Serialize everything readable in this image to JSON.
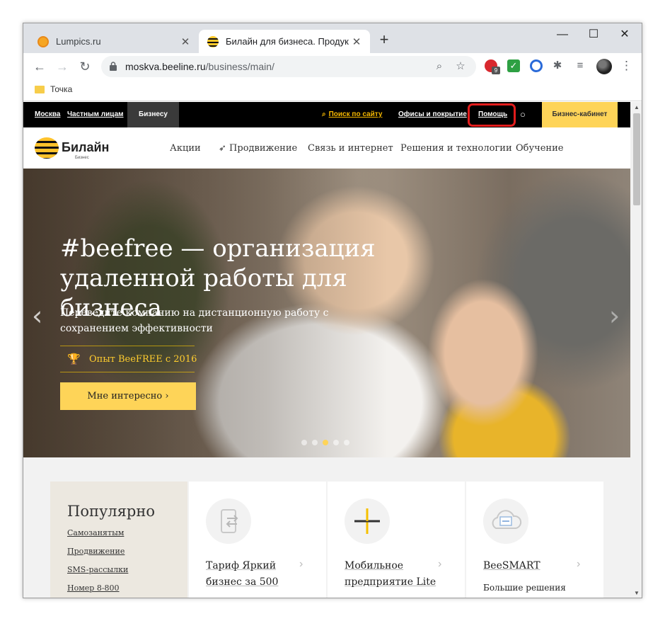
{
  "browser": {
    "tabs": [
      {
        "title": "Lumpics.ru",
        "active": false
      },
      {
        "title": "Билайн для бизнеса. Продукты",
        "active": true
      }
    ],
    "new_tab_symbol": "+",
    "window_controls": {
      "minimize": "—",
      "maximize": "☐",
      "close": "✕"
    },
    "url_host": "moskva.beeline.ru",
    "url_path": "/business/main/",
    "extension_badge": "9",
    "bookmark": "Точка"
  },
  "site": {
    "topbar": {
      "city": "Москва",
      "private": "Частным лицам",
      "business": "Бизнесу",
      "search": "Поиск по сайту",
      "offices": "Офисы и покрытие",
      "help": "Помощь",
      "cabinet": "Бизнес-кабинет"
    },
    "logo": {
      "name": "Билайн",
      "sub": "Бизнес"
    },
    "nav": [
      "Акции",
      "Продвижение",
      "Связь и интернет",
      "Решения и технологии",
      "Обучение"
    ],
    "hero": {
      "title": "#beefree — организация удаленной работы для бизнеса",
      "subtitle": "Переведите компанию на дистанционную работу с сохранением эффективности",
      "badge": "Опыт BeeFREE с 2016",
      "button": "Мне интересно ›",
      "slides": 5,
      "active_slide": 3
    },
    "popular": {
      "title": "Популярно",
      "links": [
        "Самозанятым",
        "Продвижение",
        "SMS-рассылки",
        "Номер 8-800"
      ]
    },
    "cards": [
      {
        "title": "Тариф Яркий бизнес за 500",
        "desc": ""
      },
      {
        "title": "Мобильное предприятие Lite",
        "desc": ""
      },
      {
        "title": "BeeSMART",
        "desc": "Большие решения для"
      }
    ]
  },
  "colors": {
    "accent": "#fed458",
    "highlight": "#e21c1c",
    "topbar": "#000000"
  }
}
